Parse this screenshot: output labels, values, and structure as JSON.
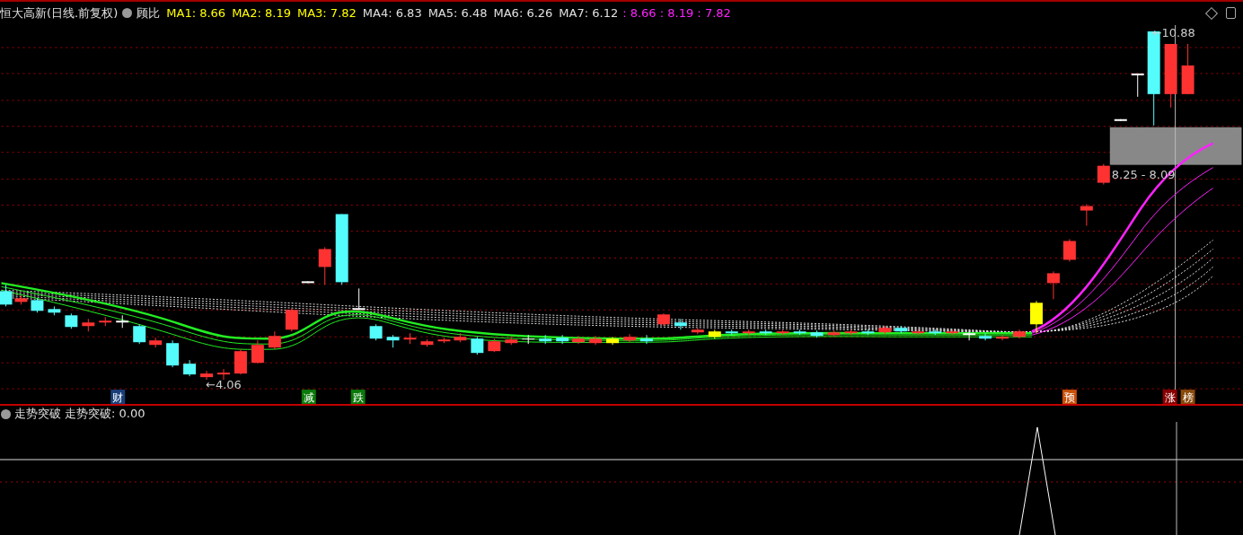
{
  "header": {
    "title": "恒大高新(日线.前复权)",
    "indicator": "顾比",
    "values": [
      {
        "label": "MA1:",
        "value": "8.66",
        "color": "#ffff00"
      },
      {
        "label": "MA2:",
        "value": "8.19",
        "color": "#ffff00"
      },
      {
        "label": "MA3:",
        "value": "7.82",
        "color": "#ffff00"
      },
      {
        "label": "MA4:",
        "value": "6.83",
        "color": "#e0e0e0"
      },
      {
        "label": "MA5:",
        "value": "6.48",
        "color": "#e0e0e0"
      },
      {
        "label": "MA6:",
        "value": "6.26",
        "color": "#e0e0e0"
      },
      {
        "label": "MA7:",
        "value": "6.12",
        "color": "#e0e0e0"
      }
    ],
    "ratio": ": 8.66 : 8.19 : 7.82"
  },
  "chart": {
    "low_label": "←4.06",
    "high_label": "←10.88",
    "range_label": "8.25 - 8.09"
  },
  "events": [
    {
      "text": "财",
      "color": "#1a3f7a"
    },
    {
      "text": "减",
      "color": "#0a7a0a"
    },
    {
      "text": "跌",
      "color": "#0a7a0a"
    },
    {
      "text": "预",
      "color": "#c8500a"
    },
    {
      "text": "涨",
      "color": "#8a0000"
    },
    {
      "text": "榜",
      "color": "#8a4a0a"
    }
  ],
  "lower_panel": {
    "title": "走势突破",
    "reading": "走势突破: 0.00"
  }
}
